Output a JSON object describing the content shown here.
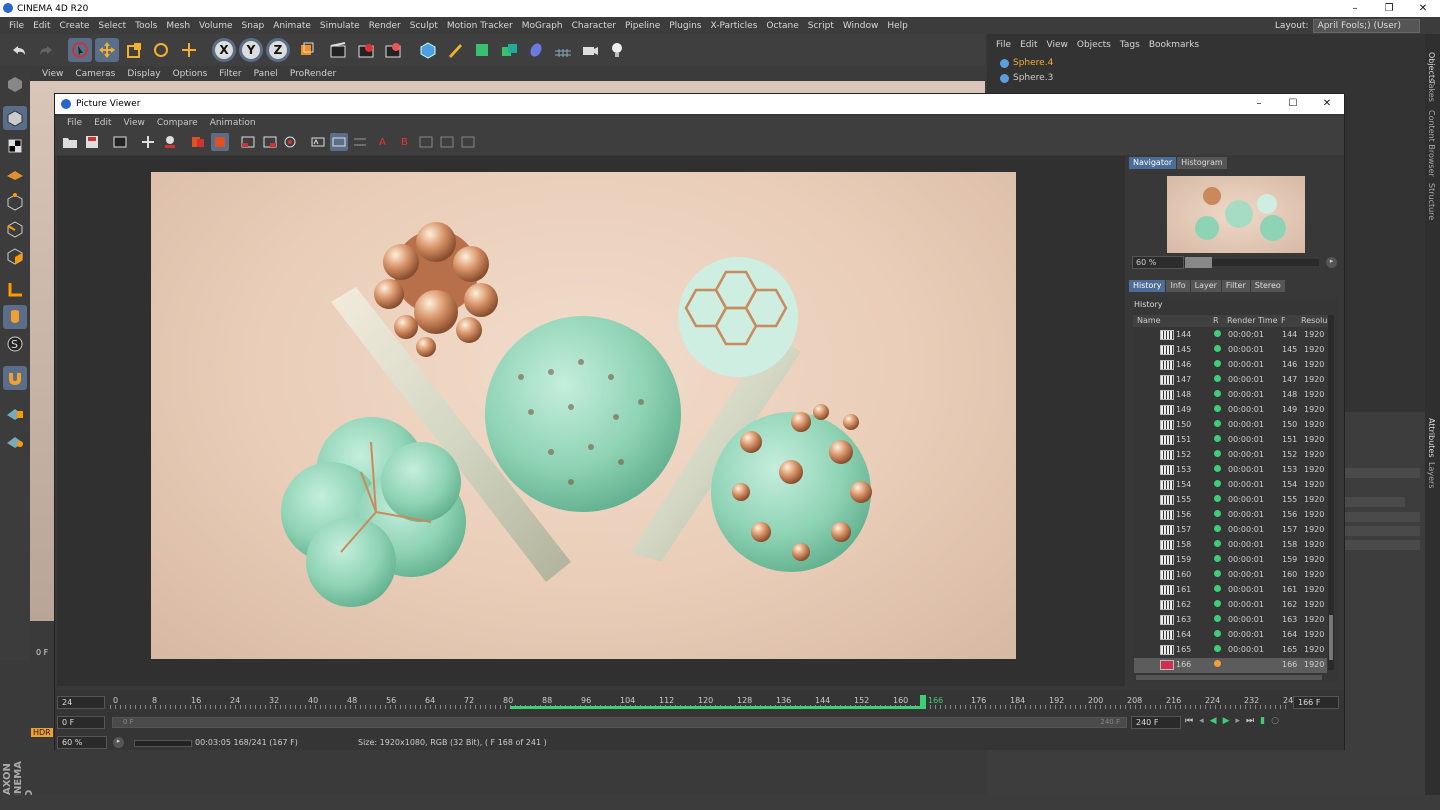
{
  "app": {
    "title": "CINEMA 4D R20"
  },
  "menu": [
    "File",
    "Edit",
    "Create",
    "Select",
    "Tools",
    "Mesh",
    "Volume",
    "Snap",
    "Animate",
    "Simulate",
    "Render",
    "Sculpt",
    "Motion Tracker",
    "MoGraph",
    "Character",
    "Pipeline",
    "Plugins",
    "X-Particles",
    "Octane",
    "Script",
    "Window",
    "Help"
  ],
  "layout": {
    "label": "Layout:",
    "value": "April Fools;) (User)"
  },
  "toolbar": {
    "x": "X",
    "y": "Y",
    "z": "Z"
  },
  "viewport_menu": [
    "View",
    "Cameras",
    "Display",
    "Options",
    "Filter",
    "Panel",
    "ProRender"
  ],
  "object_manager": {
    "menu": [
      "File",
      "Edit",
      "View",
      "Objects",
      "Tags",
      "Bookmarks"
    ],
    "objects": [
      "Sphere.4",
      "Sphere.3"
    ]
  },
  "side_labels": [
    "Objects",
    "Takes",
    "Content Browser",
    "Structure",
    "Attributes",
    "Layers"
  ],
  "picture_viewer": {
    "title": "Picture Viewer",
    "menu": [
      "File",
      "Edit",
      "View",
      "Compare",
      "Animation"
    ],
    "navigator_tabs": [
      "Navigator",
      "Histogram"
    ],
    "nav_zoom": "60 %",
    "history_tabs": [
      "History",
      "Info",
      "Layer",
      "Filter",
      "Stereo"
    ],
    "history_label": "History",
    "columns": [
      "Name",
      "R",
      "Render Time",
      "F",
      "Resolu"
    ],
    "rows": [
      {
        "name": "144",
        "time": "00:00:01",
        "f": "144",
        "res": "1920"
      },
      {
        "name": "145",
        "time": "00:00:01",
        "f": "145",
        "res": "1920"
      },
      {
        "name": "146",
        "time": "00:00:01",
        "f": "146",
        "res": "1920"
      },
      {
        "name": "147",
        "time": "00:00:01",
        "f": "147",
        "res": "1920"
      },
      {
        "name": "148",
        "time": "00:00:01",
        "f": "148",
        "res": "1920"
      },
      {
        "name": "149",
        "time": "00:00:01",
        "f": "149",
        "res": "1920"
      },
      {
        "name": "150",
        "time": "00:00:01",
        "f": "150",
        "res": "1920"
      },
      {
        "name": "151",
        "time": "00:00:01",
        "f": "151",
        "res": "1920"
      },
      {
        "name": "152",
        "time": "00:00:01",
        "f": "152",
        "res": "1920"
      },
      {
        "name": "153",
        "time": "00:00:01",
        "f": "153",
        "res": "1920"
      },
      {
        "name": "154",
        "time": "00:00:01",
        "f": "154",
        "res": "1920"
      },
      {
        "name": "155",
        "time": "00:00:01",
        "f": "155",
        "res": "1920"
      },
      {
        "name": "156",
        "time": "00:00:01",
        "f": "156",
        "res": "1920"
      },
      {
        "name": "157",
        "time": "00:00:01",
        "f": "157",
        "res": "1920"
      },
      {
        "name": "158",
        "time": "00:00:01",
        "f": "158",
        "res": "1920"
      },
      {
        "name": "159",
        "time": "00:00:01",
        "f": "159",
        "res": "1920"
      },
      {
        "name": "160",
        "time": "00:00:01",
        "f": "160",
        "res": "1920"
      },
      {
        "name": "161",
        "time": "00:00:01",
        "f": "161",
        "res": "1920"
      },
      {
        "name": "162",
        "time": "00:00:01",
        "f": "162",
        "res": "1920"
      },
      {
        "name": "163",
        "time": "00:00:01",
        "f": "163",
        "res": "1920"
      },
      {
        "name": "164",
        "time": "00:00:01",
        "f": "164",
        "res": "1920"
      },
      {
        "name": "165",
        "time": "00:00:01",
        "f": "165",
        "res": "1920"
      },
      {
        "name": "166",
        "time": "",
        "f": "166",
        "res": "1920"
      }
    ],
    "timeline": {
      "ticks": [
        "0",
        "8",
        "16",
        "24",
        "32",
        "40",
        "48",
        "56",
        "64",
        "72",
        "80",
        "88",
        "96",
        "104",
        "112",
        "120",
        "128",
        "136",
        "144",
        "152",
        "160",
        "166",
        "176",
        "184",
        "192",
        "200",
        "208",
        "216",
        "224",
        "232",
        "240"
      ],
      "fps": "24",
      "start_frame": "0 F",
      "current_frame": "166 F",
      "end_frame": "240 F",
      "end_field": "240 F",
      "scrub_start": "0 F"
    },
    "status": {
      "zoom": "60 %",
      "progress": "00:03:05 168/241 (167 F)",
      "info": "Size: 1920x1080, RGB (32 Bit), ( F 168 of 241 )"
    }
  },
  "colors": {
    "accent": "#4d6d99",
    "green": "#3ccf78",
    "orange": "#f0a030"
  },
  "bottom_left": {
    "frame_a": "0 F",
    "hdr": "HDR",
    "brand": "MAXON CINEMA 4D"
  }
}
